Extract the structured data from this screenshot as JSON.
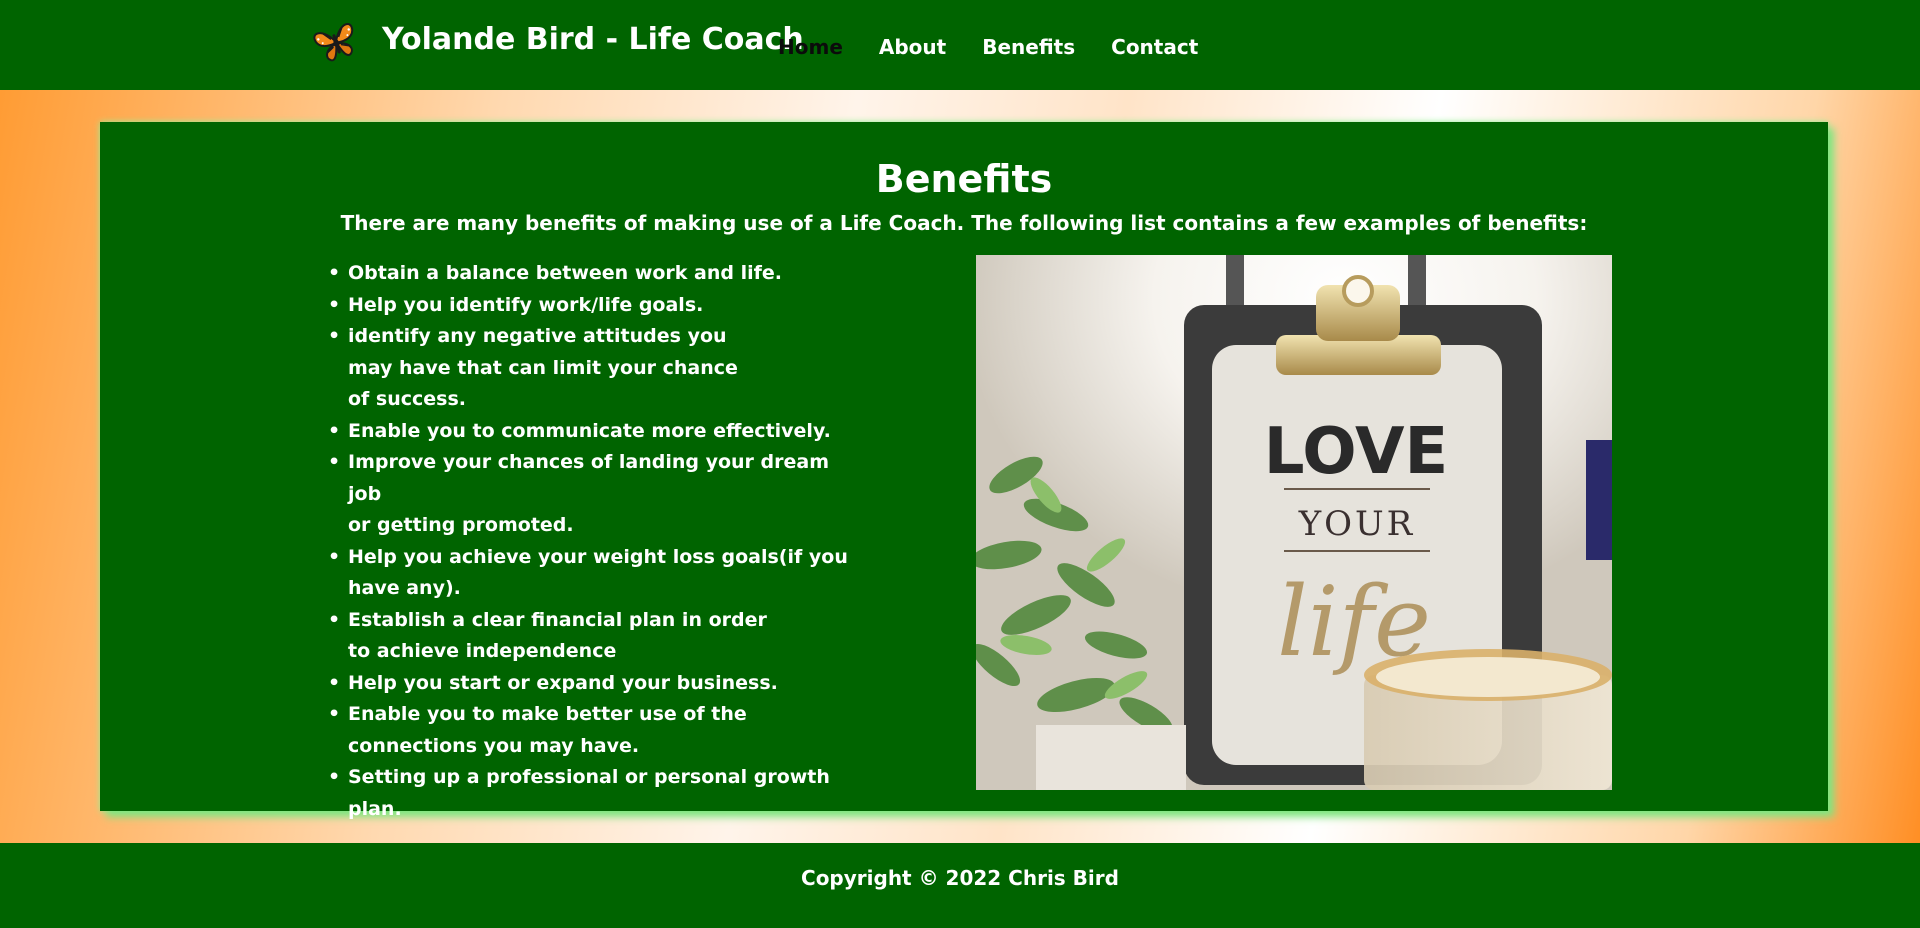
{
  "header": {
    "logo_icon": "butterfly-icon",
    "title": "Yolande Bird - Life Coach",
    "nav": [
      {
        "label": "Home",
        "active": true
      },
      {
        "label": "About",
        "active": false
      },
      {
        "label": "Benefits",
        "active": false
      },
      {
        "label": "Contact",
        "active": false
      }
    ]
  },
  "main": {
    "title": "Benefits",
    "intro": "There are many benefits of making use of a Life Coach. The following list contains a few examples of benefits:",
    "benefits": [
      "Obtain a balance between work and life.",
      "Help you identify work/life goals.",
      "identify any negative attitudes you\nmay have that can limit your chance\nof success.",
      "Enable you to communicate more effectively.",
      "Improve your chances of landing your dream job\nor getting promoted.",
      "Help you achieve your weight loss goals(if you\nhave any).",
      "Establish a clear financial plan in order\nto achieve independence",
      "Help you start or expand your business.",
      "Enable you to make better use of the\nconnections you may have.",
      "Setting up a professional or personal growth plan."
    ],
    "photo": {
      "line1": "LOVE",
      "line2": "YOUR",
      "line3": "life"
    }
  },
  "footer": {
    "copyright": "Copyright © 2022 Chris Bird"
  },
  "colors": {
    "brand_green": "#006400",
    "accent_orange": "#ff8a1c",
    "glow_green": "#7fe57f",
    "text_white": "#ffffff"
  }
}
